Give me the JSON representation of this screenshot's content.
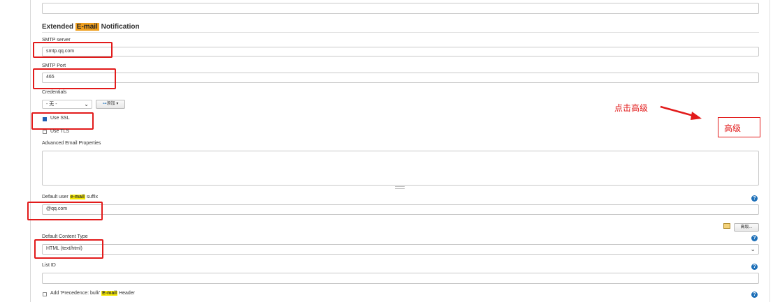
{
  "section": {
    "title_prefix": "Extended ",
    "title_highlight": "E-mail",
    "title_suffix": " Notification"
  },
  "smtp_server": {
    "label": "SMTP server",
    "value": "smtp.qq.com"
  },
  "smtp_port": {
    "label": "SMTP Port",
    "value": "465"
  },
  "credentials": {
    "label": "Credentials",
    "select_value": "- 无 -",
    "add_button": "添加"
  },
  "use_ssl": {
    "label": "Use SSL",
    "checked": true
  },
  "use_tls": {
    "label": "Use TLS",
    "checked": false
  },
  "advanced_props": {
    "label": "Advanced Email Properties",
    "value": ""
  },
  "default_suffix": {
    "label_prefix": "Default user ",
    "label_highlight": "e-mail",
    "label_suffix": " suffix",
    "value": "@qq.com"
  },
  "advanced_button": "高级...",
  "content_type": {
    "label": "Default Content Type",
    "value": "HTML (text/html)"
  },
  "list_id": {
    "label": "List ID",
    "value": ""
  },
  "precedence": {
    "label_prefix": "Add 'Precedence: bulk' ",
    "label_highlight": "E-mail",
    "label_suffix": " Header",
    "checked": false
  },
  "annotations": {
    "click_advanced": "点击高级",
    "advanced_box": "高级"
  },
  "colors": {
    "annotation_red": "#e21b1b",
    "highlight_yellow": "#f5e800",
    "highlight_orange": "#f0a020",
    "help_blue": "#1c6fb8"
  }
}
